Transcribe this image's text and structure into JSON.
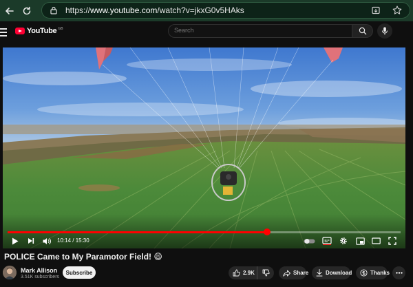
{
  "browser": {
    "url_prefix": "https://",
    "url_domain": "www.youtube.com",
    "url_path": "/watch?v=jkxG0v5HAks"
  },
  "header": {
    "logo_text": "YouTube",
    "logo_region": "GB",
    "search_placeholder": "Search"
  },
  "player": {
    "time_current": "10:14",
    "time_total": "15:30",
    "time_display": "10:14 / 15:30",
    "progress_fraction": 0.66,
    "accent_color": "#ff0000"
  },
  "video": {
    "title": "POLICE Came to My Paramotor Field! 😄"
  },
  "channel": {
    "name": "Mark Allison",
    "subscribers": "3.51K subscribers",
    "subscribe_label": "Subscribe"
  },
  "actions": {
    "like_count": "2.9K",
    "share_label": "Share",
    "download_label": "Download",
    "thanks_label": "Thanks"
  },
  "icons": [
    "back-arrow-icon",
    "reload-icon",
    "lock-icon",
    "install-app-icon",
    "favorite-star-icon",
    "menu-icon",
    "search-icon",
    "mic-icon",
    "play-icon",
    "next-icon",
    "volume-icon",
    "autoplay-toggle-icon",
    "captions-icon",
    "settings-gear-icon",
    "miniplayer-icon",
    "theater-mode-icon",
    "fullscreen-icon",
    "thumbs-up-icon",
    "thumbs-down-icon",
    "share-icon",
    "download-icon",
    "thanks-icon",
    "more-icon"
  ]
}
